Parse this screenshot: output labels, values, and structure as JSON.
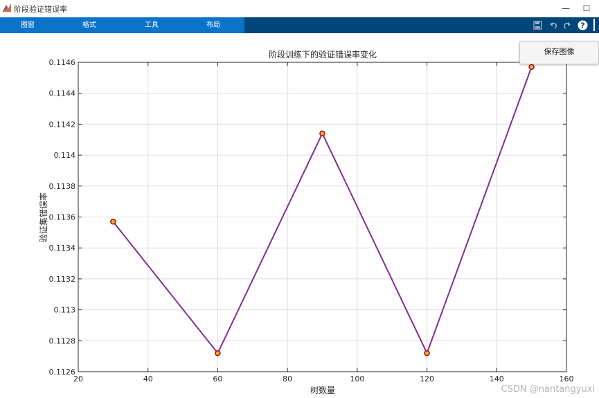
{
  "window": {
    "title": "阶段验证错误率"
  },
  "menubar": {
    "items": [
      "图窗",
      "格式",
      "工具",
      "布局"
    ]
  },
  "popup": {
    "label": "保存图像"
  },
  "chart_data": {
    "type": "line",
    "title": "阶段训练下的验证错误率变化",
    "xlabel": "树数量",
    "ylabel": "验证集错误率",
    "x": [
      30,
      60,
      90,
      120,
      150
    ],
    "series": [
      {
        "values": [
          0.11357,
          0.11272,
          0.11414,
          0.11272,
          0.11457
        ]
      }
    ],
    "xlim": [
      20,
      160
    ],
    "ylim": [
      0.1126,
      0.1146
    ],
    "xticks": [
      20,
      40,
      60,
      80,
      100,
      120,
      140,
      160
    ],
    "yticks": [
      0.1126,
      0.1128,
      0.113,
      0.1132,
      0.1134,
      0.1136,
      0.1138,
      0.114,
      0.1142,
      0.1144,
      0.1146
    ],
    "ytick_labels": [
      "0.1126",
      "0.1128",
      "0.113",
      "0.1132",
      "0.1134",
      "0.1136",
      "0.1138",
      "0.114",
      "0.1142",
      "0.1144",
      "0.1146"
    ],
    "grid": true,
    "line_color": "#7e2f8e",
    "marker_edge_color": "#a2142f",
    "marker_fill_color": "#edb120"
  },
  "watermark": "CSDN @nantangyuxi"
}
